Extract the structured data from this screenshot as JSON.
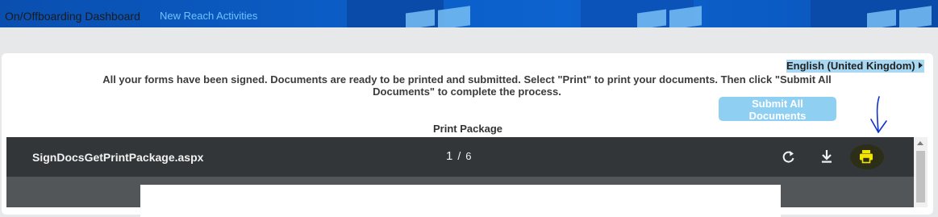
{
  "header": {
    "dashboard_link": "On/Offboarding Dashboard",
    "reach_link": "New Reach Activities"
  },
  "language": {
    "selected": "English (United Kingdom)"
  },
  "main": {
    "message": "All your forms have been signed. Documents are ready to be printed and submitted. Select \"Print\" to print your documents. Then click \"Submit All Documents\" to complete the process.",
    "submit_label": "Submit All Documents",
    "print_package_label": "Print Package"
  },
  "viewer": {
    "filename": "SignDocsGetPrintPackage.aspx",
    "current_page": "1",
    "separator": "/",
    "total_pages": "6",
    "icons": [
      "rotate-icon",
      "download-icon",
      "print-icon"
    ]
  },
  "colors": {
    "banner": "#0b5cc4",
    "submit_button": "#8fd0f2",
    "language_highlight": "#a9d8f3",
    "viewer_toolbar": "#323639",
    "print_icon": "#f2e600",
    "annotation": "#1030d0"
  }
}
